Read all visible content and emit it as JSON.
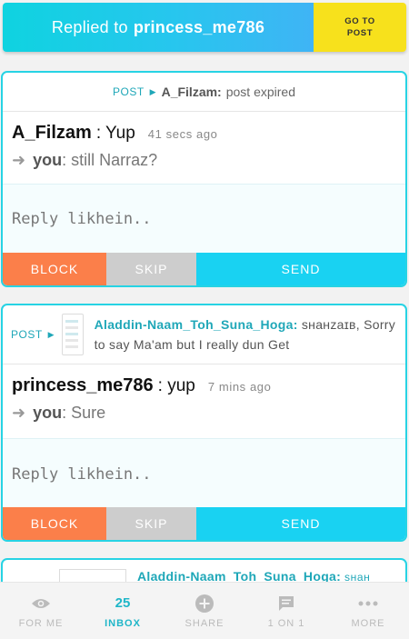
{
  "banner": {
    "prefix": "Replied to",
    "username": "princess_me786",
    "go_button": "GO TO\nPOST"
  },
  "cards": [
    {
      "post_tag": "POST",
      "post_author": "A_Filzam:",
      "post_status": "post expired",
      "message_user": "A_Filzam",
      "message_text": ": Yup",
      "message_time": "41 secs ago",
      "you_label": "you",
      "you_text": ": still Narraz?",
      "reply_placeholder": "Reply likhein..",
      "block_label": "BLOCK",
      "skip_label": "SKIP",
      "send_label": "SEND"
    },
    {
      "post_tag": "POST",
      "post_author": "Aladdin-Naam_Toh_Suna_Hoga:",
      "post_text": " sʜaʜzaɪʙ, Sorry to say Ma'am but I really dun Get",
      "message_user": "princess_me786",
      "message_text": ": yup",
      "message_time": "7 mins ago",
      "you_label": "you",
      "you_text": ": Sure",
      "reply_placeholder": "Reply likhein..",
      "block_label": "BLOCK",
      "skip_label": "SKIP",
      "send_label": "SEND"
    },
    {
      "post_author": "Aladdin-Naam_Toh_Suna_Hoga:",
      "post_text": " sʜaʜ"
    }
  ],
  "nav": {
    "items": [
      {
        "label": "FOR ME",
        "icon": "eye-icon"
      },
      {
        "label": "INBOX",
        "count": "25"
      },
      {
        "label": "SHARE",
        "icon": "plus-circle-icon"
      },
      {
        "label": "1 ON 1",
        "icon": "chat-icon"
      },
      {
        "label": "MORE",
        "icon": "more-dots-icon"
      }
    ]
  },
  "colors": {
    "accent": "#19d2f2",
    "block": "#fb7f4a",
    "skip": "#cdcdcd",
    "go_button": "#f7e11c"
  }
}
